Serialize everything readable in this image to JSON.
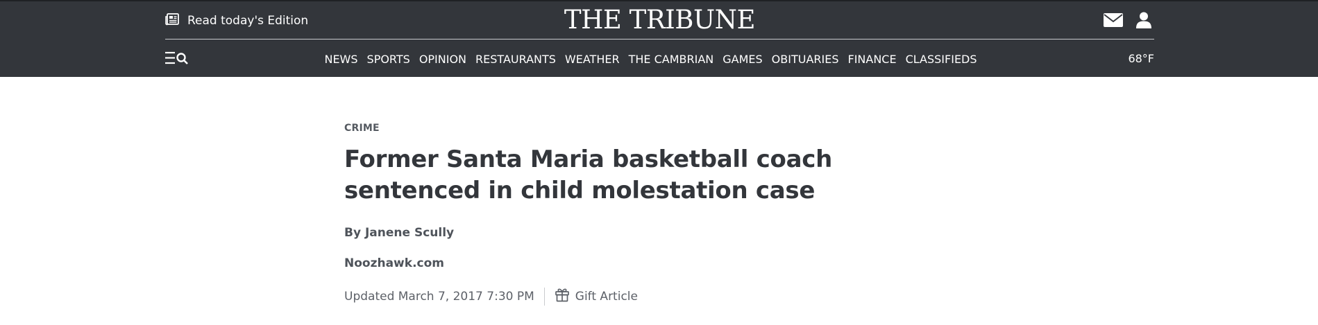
{
  "header": {
    "edition_label": "Read today's Edition",
    "logo": "THE TRIBUNE",
    "weather": "68°F",
    "icons": [
      "newspaper-icon",
      "mail-icon",
      "user-icon",
      "menu-search-icon"
    ]
  },
  "nav": {
    "items": [
      "NEWS",
      "SPORTS",
      "OPINION",
      "RESTAURANTS",
      "WEATHER",
      "THE CAMBRIAN",
      "GAMES",
      "OBITUARIES",
      "FINANCE",
      "CLASSIFIEDS"
    ]
  },
  "article": {
    "section": "CRIME",
    "headline": "Former Santa Maria basketball coach sentenced in child molestation case",
    "byline_prefix": "By ",
    "author": "Janene Scully",
    "source": "Noozhawk.com",
    "updated": "Updated March 7, 2017 7:30 PM",
    "gift_label": "Gift Article"
  },
  "colors": {
    "masthead_bg": "#33363b",
    "text_dark": "#33363b",
    "text_muted": "#5d6168"
  }
}
